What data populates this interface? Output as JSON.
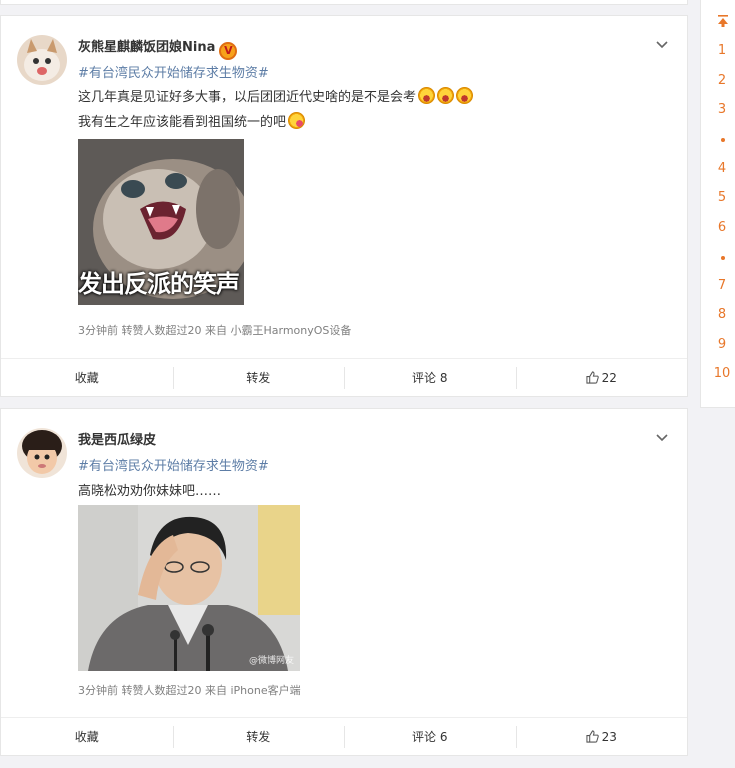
{
  "posts": [
    {
      "username": "灰熊星麒麟饭团娘Nina",
      "verified": true,
      "hashtag": "#有台湾民众开始储存求生物资#",
      "lines": [
        "这几年真是见证好多大事，以后团团近代史啥的是不是会考",
        "我有生之年应该能看到祖国统一的吧"
      ],
      "image_caption": "发出反派的笑声",
      "meta": "3分钟前 转赞人数超过20  来自 小霸王HarmonyOS设备",
      "actions": {
        "favorite": "收藏",
        "repost": "转发",
        "comment": "评论 8",
        "like": "22"
      }
    },
    {
      "username": "我是西瓜绿皮",
      "verified": false,
      "hashtag": "#有台湾民众开始储存求生物资#",
      "lines": [
        "高晓松劝劝你妹妹吧……"
      ],
      "image_watermark": "@微博网友",
      "meta": "3分钟前 转赞人数超过20  来自 iPhone客户端",
      "actions": {
        "favorite": "收藏",
        "repost": "转发",
        "comment": "评论 6",
        "like": "23"
      }
    }
  ],
  "sidenav": {
    "items": [
      "1",
      "2",
      "3",
      "4",
      "5",
      "6",
      "7",
      "8",
      "9",
      "10"
    ]
  },
  "colors": {
    "accent": "#e8772a",
    "link": "#5d7da6",
    "meta": "#808080",
    "background": "#f2f2f5"
  }
}
